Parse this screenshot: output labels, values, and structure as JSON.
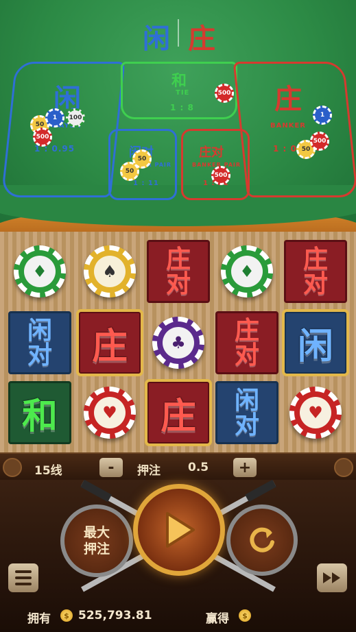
{
  "table": {
    "header_player": "闲",
    "header_banker": "庄",
    "zones": {
      "player": {
        "label": "闲",
        "sub": "PLAYER",
        "odds": "1 : 0.95"
      },
      "tie": {
        "label": "和",
        "sub": "TIE",
        "odds": "1 : 8"
      },
      "banker": {
        "label": "庄",
        "sub": "BANKER",
        "odds": "1 : 0.95"
      },
      "player_pair": {
        "label": "闲对",
        "sub": "PLAYER PAIR",
        "odds": "1 : 11"
      },
      "banker_pair": {
        "label": "庄对",
        "sub": "BANKER PAIR",
        "odds": "1 : 11"
      }
    },
    "chips": {
      "player": [
        "50",
        "1",
        "100",
        "500"
      ],
      "tie": [
        "500"
      ],
      "banker": [
        "1",
        "50",
        "500"
      ],
      "player_pair": [
        "50",
        "50"
      ],
      "banker_pair": [
        "500"
      ]
    }
  },
  "reels": {
    "symbols": {
      "banker": "庄",
      "player": "闲",
      "tie": "和",
      "banker_pair": "庄对",
      "player_pair": "闲对"
    },
    "chip_icons": {
      "diamond": "♦",
      "spade": "♠",
      "club": "♣",
      "heart": "♥"
    }
  },
  "controls": {
    "lines": "15线",
    "minus": "-",
    "bet_label": "押注",
    "bet_value": "0.5",
    "plus": "+",
    "max_bet": "最大押注",
    "max_bet_line1": "最大",
    "max_bet_line2": "押注"
  },
  "footer": {
    "balance_label": "拥有",
    "balance_value": "525,793.81",
    "win_label": "赢得",
    "coin_symbol": "$"
  },
  "colors": {
    "felt": "#2c8a45",
    "player": "#2f6fd6",
    "banker": "#d63a2f",
    "tie": "#3fcf4f",
    "gold": "#e3b84a"
  }
}
